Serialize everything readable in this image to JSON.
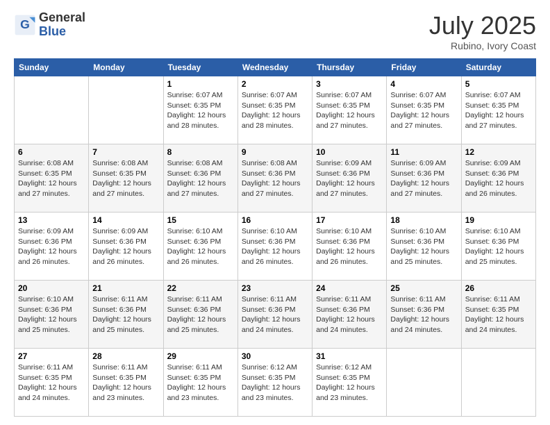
{
  "logo": {
    "general": "General",
    "blue": "Blue"
  },
  "title": "July 2025",
  "subtitle": "Rubino, Ivory Coast",
  "days_header": [
    "Sunday",
    "Monday",
    "Tuesday",
    "Wednesday",
    "Thursday",
    "Friday",
    "Saturday"
  ],
  "weeks": [
    [
      {
        "num": "",
        "sunrise": "",
        "sunset": "",
        "daylight": ""
      },
      {
        "num": "",
        "sunrise": "",
        "sunset": "",
        "daylight": ""
      },
      {
        "num": "1",
        "sunrise": "Sunrise: 6:07 AM",
        "sunset": "Sunset: 6:35 PM",
        "daylight": "Daylight: 12 hours and 28 minutes."
      },
      {
        "num": "2",
        "sunrise": "Sunrise: 6:07 AM",
        "sunset": "Sunset: 6:35 PM",
        "daylight": "Daylight: 12 hours and 28 minutes."
      },
      {
        "num": "3",
        "sunrise": "Sunrise: 6:07 AM",
        "sunset": "Sunset: 6:35 PM",
        "daylight": "Daylight: 12 hours and 27 minutes."
      },
      {
        "num": "4",
        "sunrise": "Sunrise: 6:07 AM",
        "sunset": "Sunset: 6:35 PM",
        "daylight": "Daylight: 12 hours and 27 minutes."
      },
      {
        "num": "5",
        "sunrise": "Sunrise: 6:07 AM",
        "sunset": "Sunset: 6:35 PM",
        "daylight": "Daylight: 12 hours and 27 minutes."
      }
    ],
    [
      {
        "num": "6",
        "sunrise": "Sunrise: 6:08 AM",
        "sunset": "Sunset: 6:35 PM",
        "daylight": "Daylight: 12 hours and 27 minutes."
      },
      {
        "num": "7",
        "sunrise": "Sunrise: 6:08 AM",
        "sunset": "Sunset: 6:35 PM",
        "daylight": "Daylight: 12 hours and 27 minutes."
      },
      {
        "num": "8",
        "sunrise": "Sunrise: 6:08 AM",
        "sunset": "Sunset: 6:36 PM",
        "daylight": "Daylight: 12 hours and 27 minutes."
      },
      {
        "num": "9",
        "sunrise": "Sunrise: 6:08 AM",
        "sunset": "Sunset: 6:36 PM",
        "daylight": "Daylight: 12 hours and 27 minutes."
      },
      {
        "num": "10",
        "sunrise": "Sunrise: 6:09 AM",
        "sunset": "Sunset: 6:36 PM",
        "daylight": "Daylight: 12 hours and 27 minutes."
      },
      {
        "num": "11",
        "sunrise": "Sunrise: 6:09 AM",
        "sunset": "Sunset: 6:36 PM",
        "daylight": "Daylight: 12 hours and 27 minutes."
      },
      {
        "num": "12",
        "sunrise": "Sunrise: 6:09 AM",
        "sunset": "Sunset: 6:36 PM",
        "daylight": "Daylight: 12 hours and 26 minutes."
      }
    ],
    [
      {
        "num": "13",
        "sunrise": "Sunrise: 6:09 AM",
        "sunset": "Sunset: 6:36 PM",
        "daylight": "Daylight: 12 hours and 26 minutes."
      },
      {
        "num": "14",
        "sunrise": "Sunrise: 6:09 AM",
        "sunset": "Sunset: 6:36 PM",
        "daylight": "Daylight: 12 hours and 26 minutes."
      },
      {
        "num": "15",
        "sunrise": "Sunrise: 6:10 AM",
        "sunset": "Sunset: 6:36 PM",
        "daylight": "Daylight: 12 hours and 26 minutes."
      },
      {
        "num": "16",
        "sunrise": "Sunrise: 6:10 AM",
        "sunset": "Sunset: 6:36 PM",
        "daylight": "Daylight: 12 hours and 26 minutes."
      },
      {
        "num": "17",
        "sunrise": "Sunrise: 6:10 AM",
        "sunset": "Sunset: 6:36 PM",
        "daylight": "Daylight: 12 hours and 26 minutes."
      },
      {
        "num": "18",
        "sunrise": "Sunrise: 6:10 AM",
        "sunset": "Sunset: 6:36 PM",
        "daylight": "Daylight: 12 hours and 25 minutes."
      },
      {
        "num": "19",
        "sunrise": "Sunrise: 6:10 AM",
        "sunset": "Sunset: 6:36 PM",
        "daylight": "Daylight: 12 hours and 25 minutes."
      }
    ],
    [
      {
        "num": "20",
        "sunrise": "Sunrise: 6:10 AM",
        "sunset": "Sunset: 6:36 PM",
        "daylight": "Daylight: 12 hours and 25 minutes."
      },
      {
        "num": "21",
        "sunrise": "Sunrise: 6:11 AM",
        "sunset": "Sunset: 6:36 PM",
        "daylight": "Daylight: 12 hours and 25 minutes."
      },
      {
        "num": "22",
        "sunrise": "Sunrise: 6:11 AM",
        "sunset": "Sunset: 6:36 PM",
        "daylight": "Daylight: 12 hours and 25 minutes."
      },
      {
        "num": "23",
        "sunrise": "Sunrise: 6:11 AM",
        "sunset": "Sunset: 6:36 PM",
        "daylight": "Daylight: 12 hours and 24 minutes."
      },
      {
        "num": "24",
        "sunrise": "Sunrise: 6:11 AM",
        "sunset": "Sunset: 6:36 PM",
        "daylight": "Daylight: 12 hours and 24 minutes."
      },
      {
        "num": "25",
        "sunrise": "Sunrise: 6:11 AM",
        "sunset": "Sunset: 6:36 PM",
        "daylight": "Daylight: 12 hours and 24 minutes."
      },
      {
        "num": "26",
        "sunrise": "Sunrise: 6:11 AM",
        "sunset": "Sunset: 6:35 PM",
        "daylight": "Daylight: 12 hours and 24 minutes."
      }
    ],
    [
      {
        "num": "27",
        "sunrise": "Sunrise: 6:11 AM",
        "sunset": "Sunset: 6:35 PM",
        "daylight": "Daylight: 12 hours and 24 minutes."
      },
      {
        "num": "28",
        "sunrise": "Sunrise: 6:11 AM",
        "sunset": "Sunset: 6:35 PM",
        "daylight": "Daylight: 12 hours and 23 minutes."
      },
      {
        "num": "29",
        "sunrise": "Sunrise: 6:11 AM",
        "sunset": "Sunset: 6:35 PM",
        "daylight": "Daylight: 12 hours and 23 minutes."
      },
      {
        "num": "30",
        "sunrise": "Sunrise: 6:12 AM",
        "sunset": "Sunset: 6:35 PM",
        "daylight": "Daylight: 12 hours and 23 minutes."
      },
      {
        "num": "31",
        "sunrise": "Sunrise: 6:12 AM",
        "sunset": "Sunset: 6:35 PM",
        "daylight": "Daylight: 12 hours and 23 minutes."
      },
      {
        "num": "",
        "sunrise": "",
        "sunset": "",
        "daylight": ""
      },
      {
        "num": "",
        "sunrise": "",
        "sunset": "",
        "daylight": ""
      }
    ]
  ]
}
